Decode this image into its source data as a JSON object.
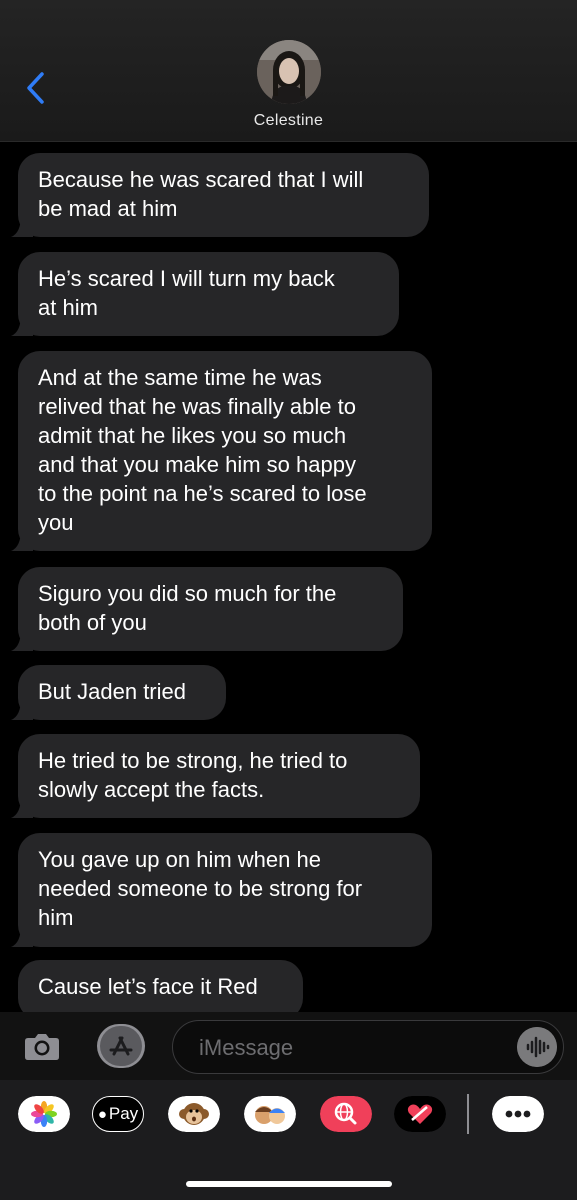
{
  "header": {
    "contact_name": "Celestine"
  },
  "messages": [
    {
      "line1": "Because he was scared that I will",
      "line2": "be mad at him"
    },
    {
      "line1": "He’s scared I will turn my back",
      "line2": "at him"
    },
    {
      "lines": [
        "And at the same time he was",
        "relived that he was finally able to",
        "admit that he likes you so much",
        "and that you make him so happy",
        "to the point na he’s scared to lose",
        "you"
      ]
    },
    {
      "line1": "Siguro you did so much for the",
      "line2": "both of you"
    },
    {
      "line1": "But Jaden tried"
    },
    {
      "line1": "He tried to be strong, he tried to",
      "line2": "slowly accept the facts."
    },
    {
      "lines": [
        "You gave up on him when he",
        "needed someone to be strong for",
        "him"
      ]
    },
    {
      "line1": "Cause let’s face it Red"
    }
  ],
  "composer": {
    "placeholder": "iMessage"
  },
  "tray": {
    "applepay_label": "Pay",
    "apps": [
      "photos-app",
      "apple-pay-app",
      "animoji-app",
      "memoji-stickers-app",
      "web-search-app",
      "digital-touch-app",
      "more-apps"
    ]
  }
}
